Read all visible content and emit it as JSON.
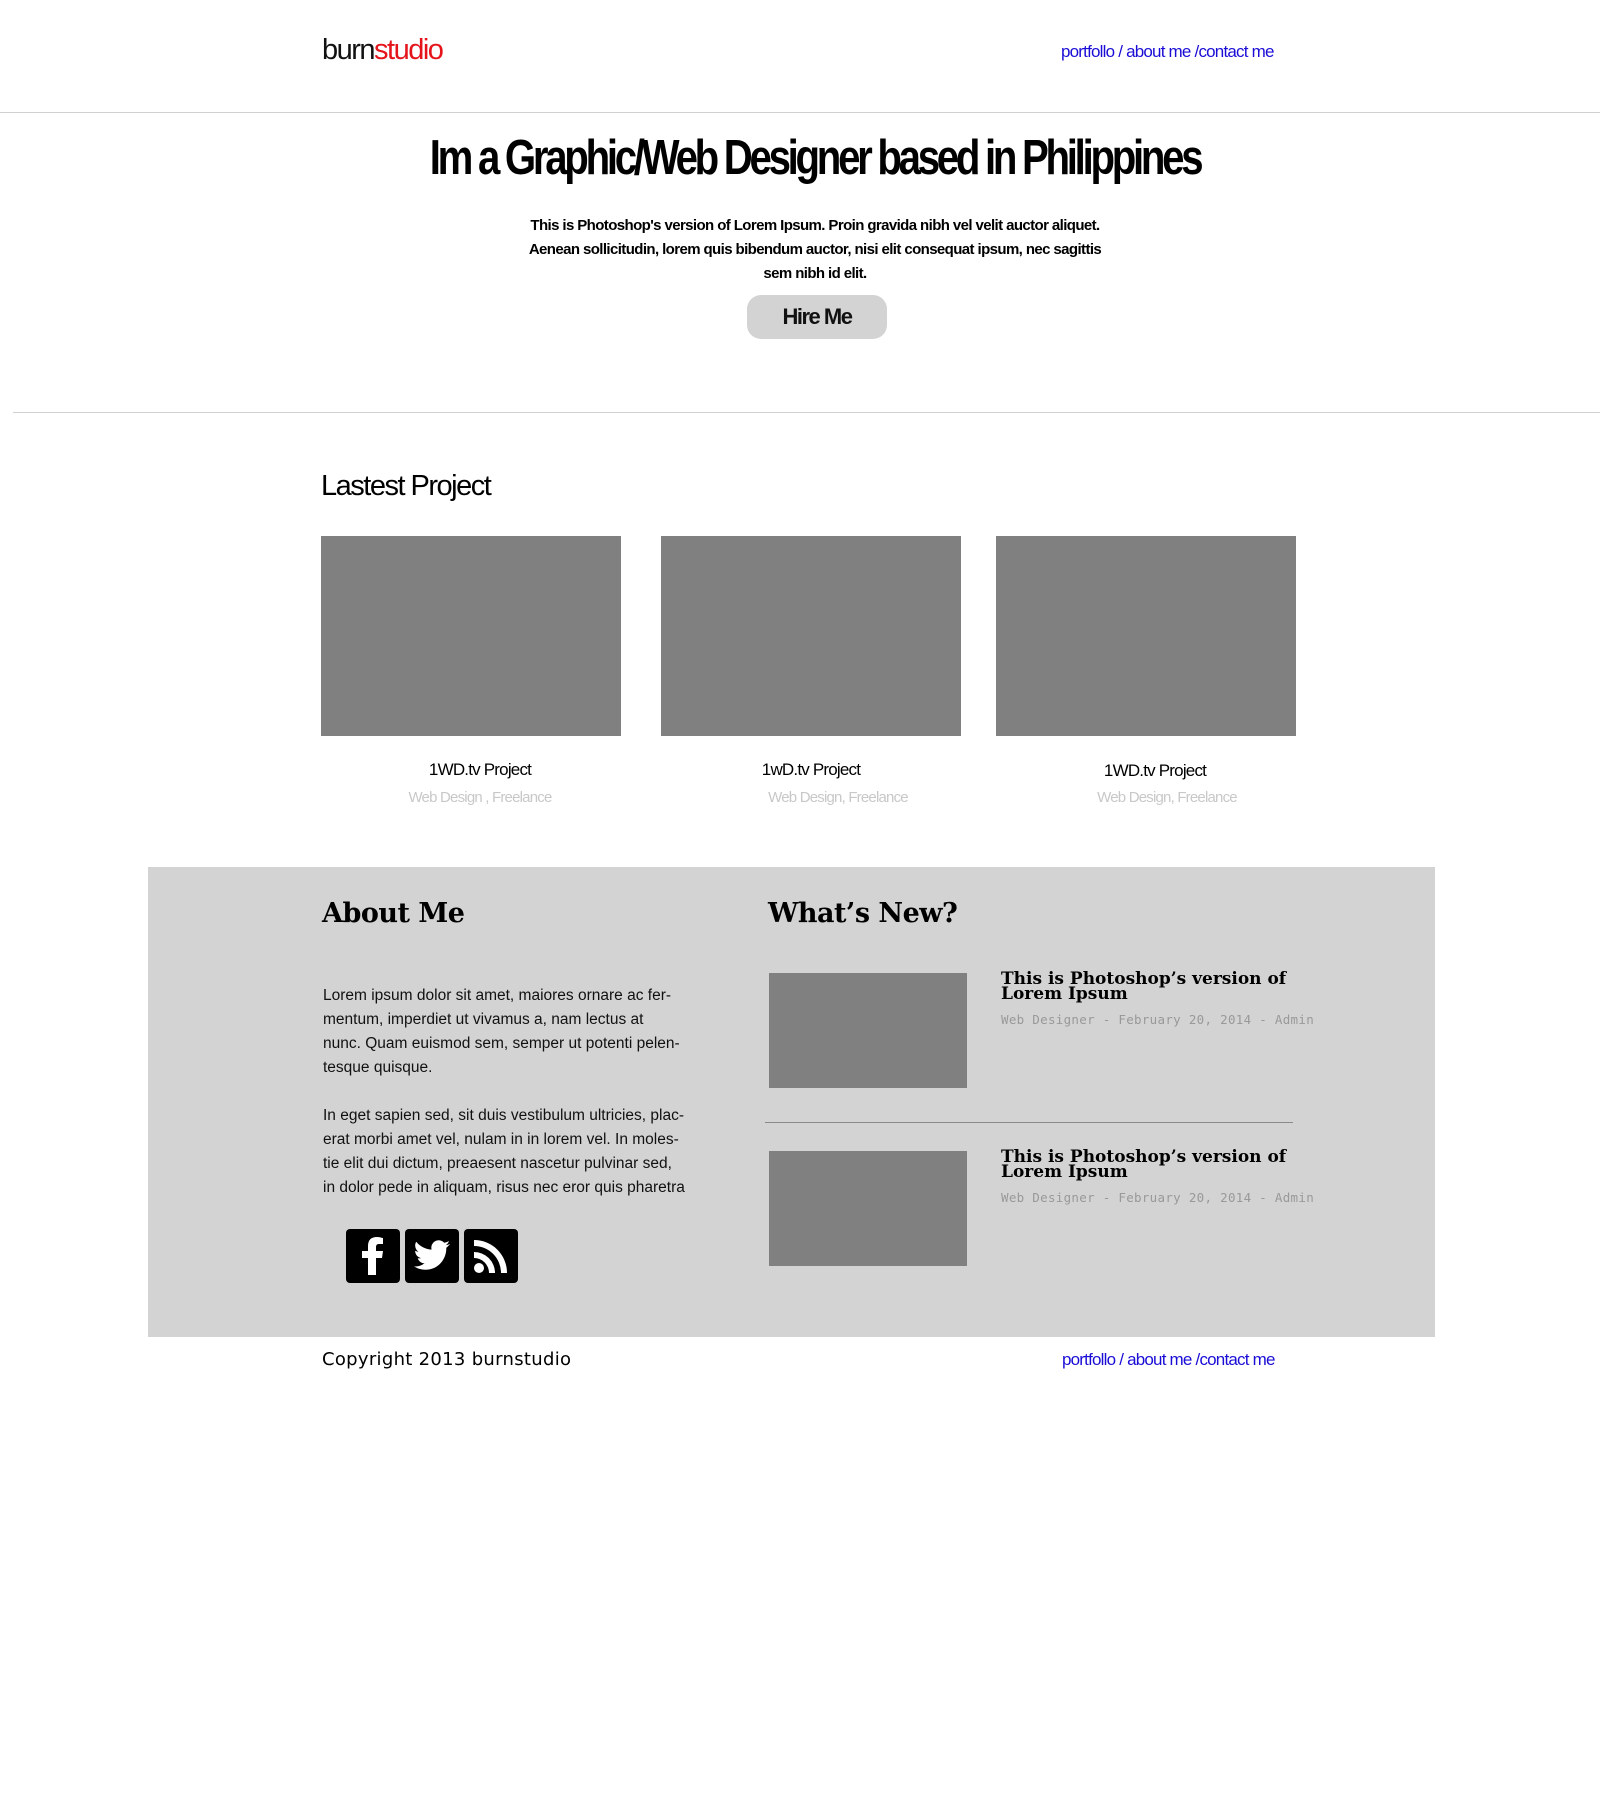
{
  "header": {
    "logo_part1": "burn",
    "logo_part2": "studio",
    "nav": {
      "portfolio": "portfollo",
      "sep1": "/",
      "about": "about me",
      "sep2": "/",
      "contact": "contact me"
    }
  },
  "hero": {
    "title": "Im a Graphic/Web Designer based in Philippines",
    "line1": "This is Photoshop's version  of Lorem Ipsum. Proin gravida nibh vel velit auctor aliquet.",
    "line2": "Aenean sollicitudin, lorem quis bibendum auctor, nisi elit consequat ipsum, nec sagittis",
    "line3": "sem nibh id elit.",
    "cta": "Hire Me"
  },
  "projects": {
    "heading": "Lastest Project",
    "items": [
      {
        "title": "1WD.tv Project",
        "subtitle": "Web Design , Freelance"
      },
      {
        "title": "1wD.tv Project",
        "subtitle": "Web Design, Freelance"
      },
      {
        "title": "1WD.tv Project",
        "subtitle": "Web Design, Freelance"
      }
    ]
  },
  "about": {
    "heading": "About Me",
    "para1": [
      "Lorem ipsum dolor sit amet, maiores ornare ac fer-",
      "mentum, imperdiet ut vivamus a, nam lectus at",
      "nunc. Quam euismod sem, semper ut potenti pelen-",
      "tesque quisque."
    ],
    "para2": [
      "In eget sapien sed, sit duis vestibulum ultricies, plac-",
      "erat morbi amet vel, nulam in in lorem vel. In moles-",
      "tie elit dui dictum, preaesent nascetur pulvinar sed,",
      "in dolor pede in aliquam, risus nec eror quis pharetra"
    ],
    "social_icons": [
      "facebook-icon",
      "twitter-icon",
      "rss-icon"
    ]
  },
  "news": {
    "heading": "What’s New?",
    "items": [
      {
        "title_line1": "This is Photoshop’s version of",
        "title_line2": "Lorem Ipsum",
        "meta": "Web Designer - February 20, 2014 - Admin"
      },
      {
        "title_line1": "This is Photoshop’s version of",
        "title_line2": "Lorem Ipsum",
        "meta": "Web Designer - February 20, 2014 - Admin"
      }
    ]
  },
  "footer": {
    "copyright": "Copyright 2013 burnstudio",
    "nav": {
      "portfolio": "portfollo",
      "sep1": "/",
      "about": "about me",
      "sep2": "/",
      "contact": "contact me"
    }
  },
  "colors": {
    "accent_red": "#e5141b",
    "link_blue": "#1a0dd6",
    "panel_grey": "#d3d3d3",
    "thumb_grey": "#808080"
  }
}
